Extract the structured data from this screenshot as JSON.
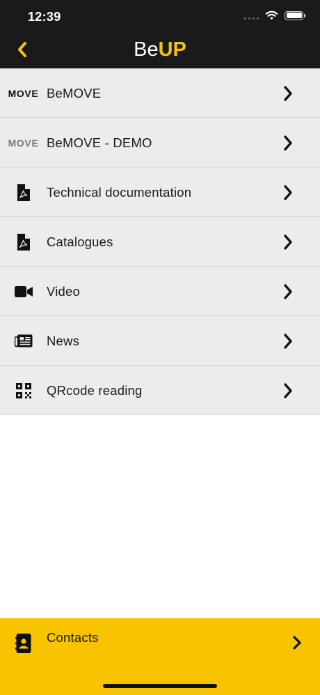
{
  "status_bar": {
    "time": "12:39"
  },
  "header": {
    "title_prefix": "Be",
    "title_suffix": "UP",
    "back_icon": "chevron-left-icon",
    "accent_color": "#f6c20d",
    "bar_color": "#1a1a1a"
  },
  "menu": {
    "items": [
      {
        "label": "BeMOVE",
        "icon": "move-logo",
        "logo_text": "MOVE"
      },
      {
        "label": "BeMOVE - DEMO",
        "icon": "move-logo-grey",
        "logo_text": "MOVE"
      },
      {
        "label": "Technical documentation",
        "icon": "pdf-file-icon"
      },
      {
        "label": "Catalogues",
        "icon": "pdf-file-icon"
      },
      {
        "label": "Video",
        "icon": "video-camera-icon"
      },
      {
        "label": "News",
        "icon": "newspaper-icon"
      },
      {
        "label": "QRcode reading",
        "icon": "qrcode-icon"
      }
    ]
  },
  "contacts": {
    "label": "Contacts",
    "icon": "address-book-icon",
    "bar_color": "#f8c300"
  }
}
